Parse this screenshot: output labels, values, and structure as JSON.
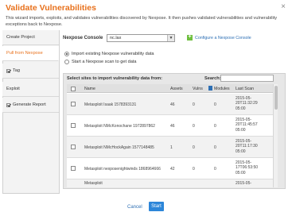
{
  "window": {
    "title": "Validate Vulnerabilities",
    "close_glyph": "×",
    "description": "This wizard imports, exploits, and validates vulnerabilities discovered by Nexpose. It then pushes validated vulnerabilities and vulnerability exceptions back to Nexpose."
  },
  "nav": {
    "items": [
      {
        "label": "Create Project",
        "active": false,
        "checked": false
      },
      {
        "label": "Pull from Nexpose",
        "active": true,
        "checked": false
      },
      {
        "label": "Tag",
        "active": false,
        "checked": true
      },
      {
        "label": "Exploit",
        "active": false,
        "checked": false
      },
      {
        "label": "Generate Report",
        "active": false,
        "checked": true
      }
    ]
  },
  "console": {
    "label": "Nexpose Console",
    "selected": "nc.lax",
    "caret": "▼",
    "config_icon": "+",
    "config_link": "Configure a Nexpose Console"
  },
  "options": {
    "import_label": "Import existing Nexpose vulnerability data",
    "scan_label": "Start a Nexpose scan to get data",
    "selected": "import"
  },
  "sites": {
    "label": "Select sites to import vulnerability data from:",
    "search_label": "Search:",
    "search_value": "",
    "columns": {
      "name": "Name",
      "assets": "Assets",
      "vulns": "Vulns",
      "modules": "Modules",
      "last_scan": "Last Scan"
    },
    "rows": [
      {
        "name": "Metasploit Isaak 1578393131",
        "assets": "46",
        "vulns": "0",
        "modules": "0",
        "scan1": "2015-05-",
        "scan2": "20T11:32:29",
        "scan3": "05:00"
      },
      {
        "name": "Metasploit NMcKonochane 1972897862",
        "assets": "46",
        "vulns": "0",
        "modules": "0",
        "scan1": "2015-05-",
        "scan2": "20T11:45:57",
        "scan3": "05:00"
      },
      {
        "name": "Metasploit NMcHockAgain 1577148485",
        "assets": "1",
        "vulns": "0",
        "modules": "0",
        "scan1": "2015-05-",
        "scan2": "20T11:17:30",
        "scan3": "05:00"
      },
      {
        "name": "Metasploit nexposenightwinds 1868964666",
        "assets": "42",
        "vulns": "0",
        "modules": "0",
        "scan1": "2015-05-",
        "scan2": "17T06:53:50",
        "scan3": "05:00"
      },
      {
        "name": "Metasploit",
        "assets": "",
        "vulns": "",
        "modules": "",
        "scan1": "2015-05-",
        "scan2": "",
        "scan3": ""
      }
    ]
  },
  "footer": {
    "cancel_label": "Cancel",
    "start_label": "Start"
  },
  "colors": {
    "title": "#e8711c",
    "link": "#2d6fb4",
    "start_button": "#2d86d9",
    "config_icon": "#6fbf3f"
  }
}
